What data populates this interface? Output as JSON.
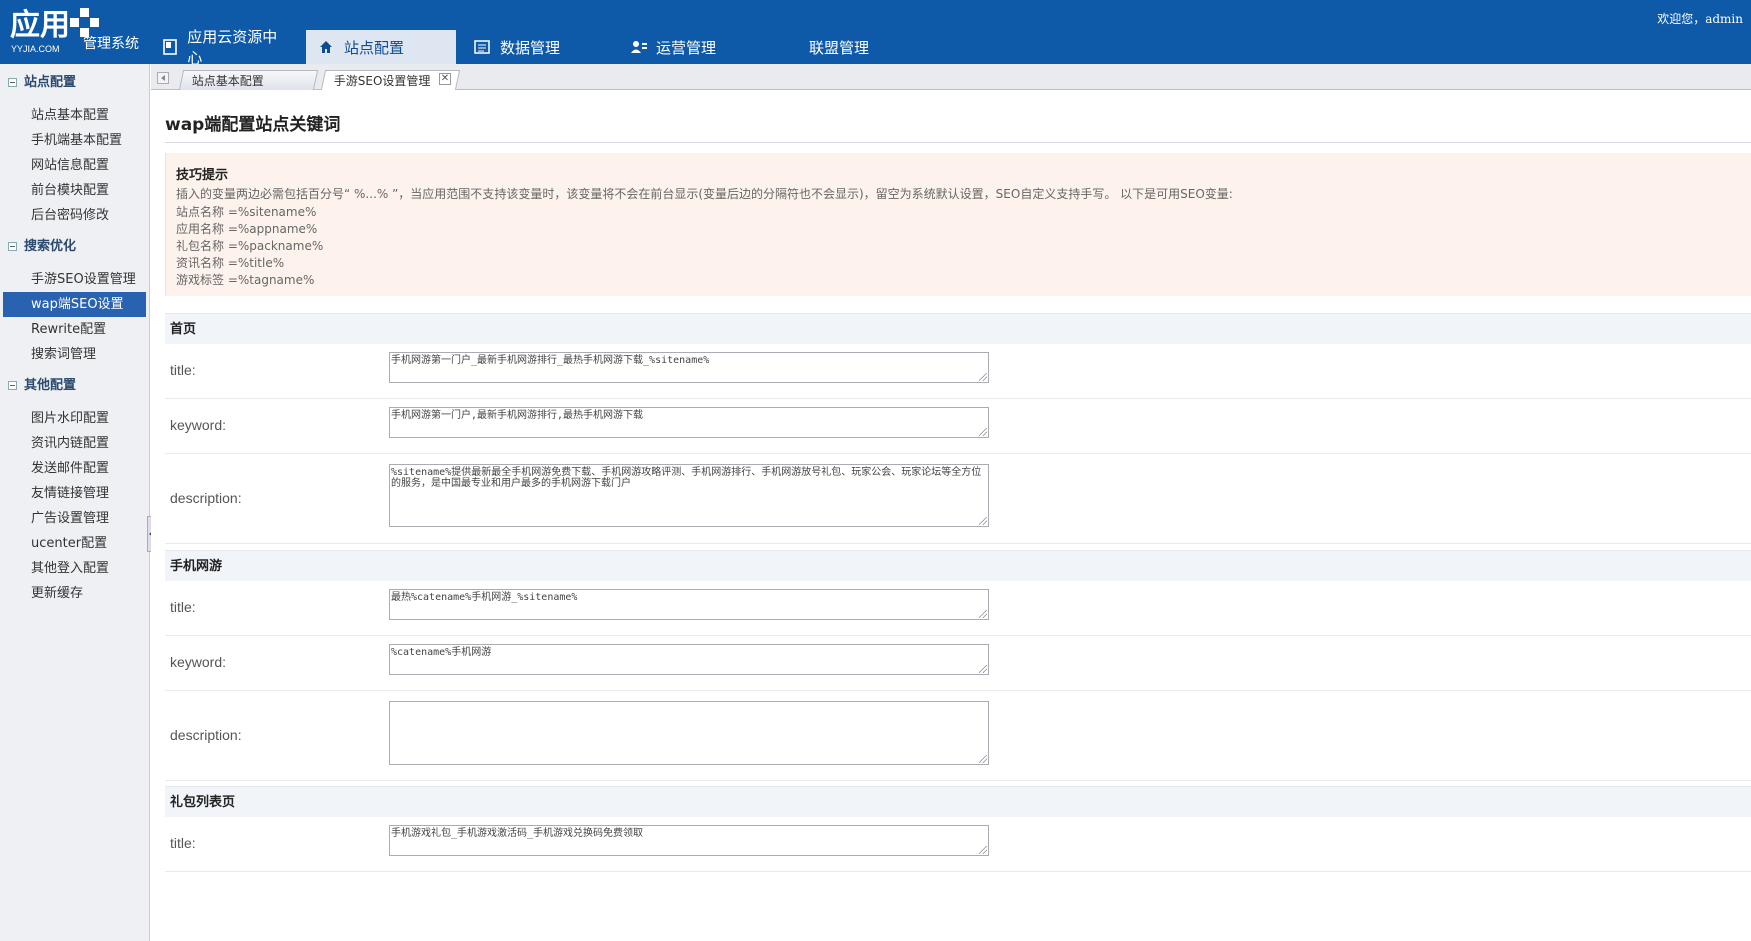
{
  "header": {
    "logo_text": "应用",
    "logo_sub": "YYJIA.COM",
    "system_name": "管理系统",
    "welcome": "欢迎您，admin",
    "nav": [
      {
        "label": "应用云资源中心",
        "icon": "resource-icon"
      },
      {
        "label": "站点配置",
        "icon": "home-icon",
        "active": true
      },
      {
        "label": "数据管理",
        "icon": "list-icon"
      },
      {
        "label": "运营管理",
        "icon": "users-icon"
      },
      {
        "label": "联盟管理",
        "icon": ""
      }
    ]
  },
  "sidebar": {
    "groups": [
      {
        "title": "站点配置",
        "items": [
          "站点基本配置",
          "手机端基本配置",
          "网站信息配置",
          "前台模块配置",
          "后台密码修改"
        ]
      },
      {
        "title": "搜索优化",
        "items": [
          "手游SEO设置管理",
          "wap端SEO设置",
          "Rewrite配置",
          "搜索词管理"
        ],
        "active_item": "wap端SEO设置"
      },
      {
        "title": "其他配置",
        "items": [
          "图片水印配置",
          "资讯内链配置",
          "发送邮件配置",
          "友情链接管理",
          "广告设置管理",
          "ucenter配置",
          "其他登入配置",
          "更新缓存"
        ]
      }
    ]
  },
  "tabs": [
    {
      "label": "站点基本配置"
    },
    {
      "label": "手游SEO设置管理",
      "active": true
    }
  ],
  "main": {
    "title": "wap端配置站点关键词",
    "tips": {
      "heading": "技巧提示",
      "lines": [
        "插入的变量两边必需包括百分号“ %...% ”，当应用范围不支持该变量时，该变量将不会在前台显示(变量后边的分隔符也不会显示)，留空为系统默认设置，SEO自定义支持手写。 以下是可用SEO变量:",
        "站点名称 =%sitename%",
        "应用名称 =%appname%",
        "礼包名称 =%packname%",
        "资讯名称 =%title%",
        "游戏标签 =%tagname%"
      ]
    },
    "sections": [
      {
        "title": "首页",
        "fields": [
          {
            "label": "title:",
            "value": "手机网游第一门户_最新手机网游排行_最热手机网游下载_%sitename%"
          },
          {
            "label": "keyword:",
            "value": "手机网游第一门户,最新手机网游排行,最热手机网游下载"
          },
          {
            "label": "description:",
            "value": "%sitename%提供最新最全手机网游免费下载、手机网游攻略评测、手机网游排行、手机网游放号礼包、玩家公会、玩家论坛等全方位的服务，是中国最专业和用户最多的手机网游下载门户"
          }
        ]
      },
      {
        "title": "手机网游",
        "fields": [
          {
            "label": "title:",
            "value": "最热%catename%手机网游_%sitename%"
          },
          {
            "label": "keyword:",
            "value": "%catename%手机网游"
          },
          {
            "label": "description:",
            "value": ""
          }
        ]
      },
      {
        "title": "礼包列表页",
        "fields": [
          {
            "label": "title:",
            "value": "手机游戏礼包_手机游戏激活码_手机游戏兑换码免费领取"
          }
        ]
      }
    ]
  }
}
